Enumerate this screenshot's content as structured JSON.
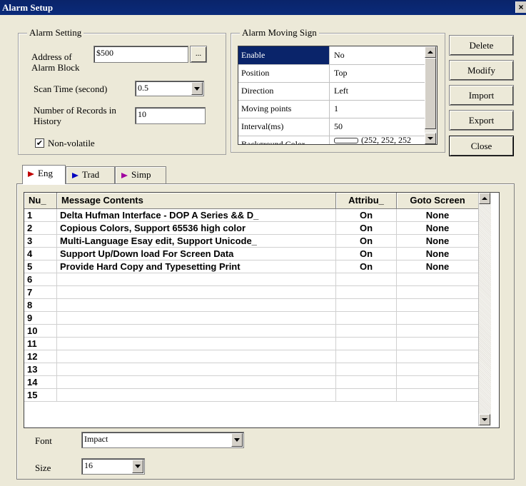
{
  "window": {
    "title": "Alarm Setup",
    "close_glyph": "×"
  },
  "alarm_setting": {
    "group_label": "Alarm Setting",
    "address_label": "Address of Alarm Block",
    "address_value": "$500",
    "browse_label": "...",
    "scan_time_label": "Scan Time (second)",
    "scan_time_value": "0.5",
    "records_label": "Number of Records in History",
    "records_value": "10",
    "non_volatile_label": "Non-volatile",
    "non_volatile_checked": "✔"
  },
  "moving_sign": {
    "group_label": "Alarm Moving Sign",
    "rows": [
      {
        "key": "Enable",
        "value": "No"
      },
      {
        "key": "Position",
        "value": "Top"
      },
      {
        "key": "Direction",
        "value": "Left"
      },
      {
        "key": "Moving points",
        "value": "1"
      },
      {
        "key": "Interval(ms)",
        "value": "50"
      },
      {
        "key": "Background Color",
        "value": "(252, 252, 252"
      }
    ],
    "bg_color_swatch": "#fcfcfc"
  },
  "buttons": {
    "delete": "Delete",
    "modify": "Modify",
    "import": "Import",
    "export": "Export",
    "close": "Close"
  },
  "tabs": [
    {
      "label": "Eng",
      "flag_color": "#c00000"
    },
    {
      "label": "Trad",
      "flag_color": "#0000c0"
    },
    {
      "label": "Simp",
      "flag_color": "#a000a0"
    }
  ],
  "table": {
    "headers": [
      "Nu_",
      "Message Contents",
      "Attribu_",
      "Goto Screen"
    ],
    "rows": [
      [
        "1",
        "Delta Hufman Interface - DOP A Series && D_",
        "On",
        "None"
      ],
      [
        "2",
        "Copious Colors, Support 65536 high color",
        "On",
        "None"
      ],
      [
        "3",
        "Multi-Language Esay edit, Support Unicode_",
        "On",
        "None"
      ],
      [
        "4",
        "Support Up/Down load For Screen Data",
        "On",
        "None"
      ],
      [
        "5",
        "Provide Hard Copy and Typesetting Print",
        "On",
        "None"
      ],
      [
        "6",
        "",
        "",
        ""
      ],
      [
        "7",
        "",
        "",
        ""
      ],
      [
        "8",
        "",
        "",
        ""
      ],
      [
        "9",
        "",
        "",
        ""
      ],
      [
        "10",
        "",
        "",
        ""
      ],
      [
        "11",
        "",
        "",
        ""
      ],
      [
        "12",
        "",
        "",
        ""
      ],
      [
        "13",
        "",
        "",
        ""
      ],
      [
        "14",
        "",
        "",
        ""
      ],
      [
        "15",
        "",
        "",
        ""
      ]
    ]
  },
  "font": {
    "font_label": "Font",
    "font_value": "Impact",
    "size_label": "Size",
    "size_value": "16"
  }
}
